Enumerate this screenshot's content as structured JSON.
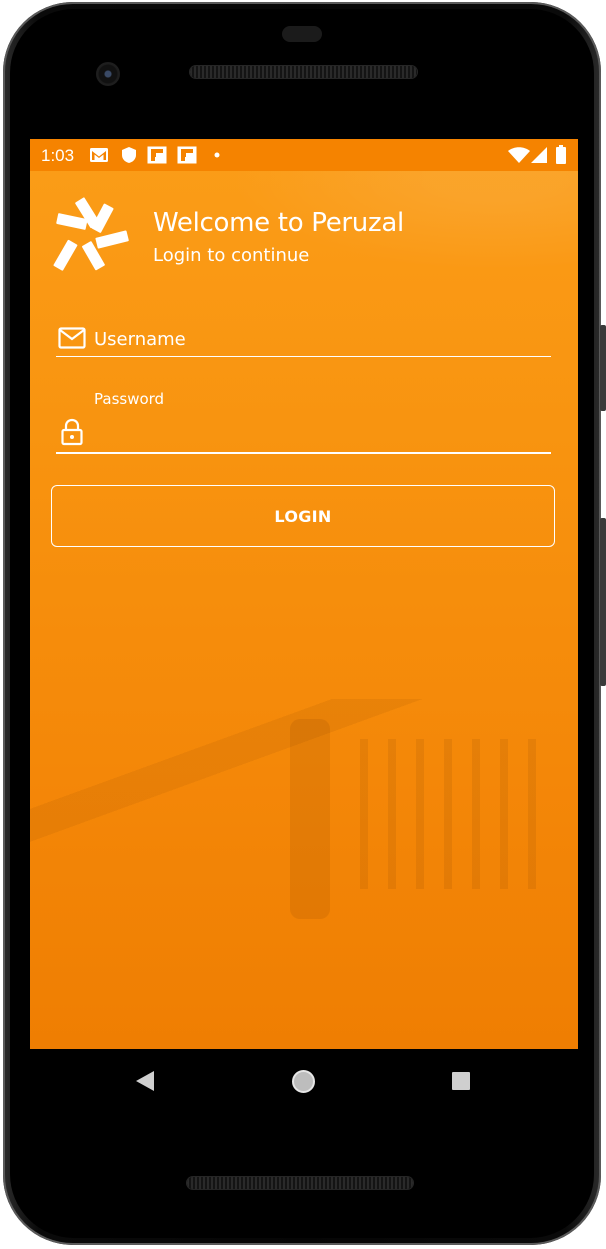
{
  "status_bar": {
    "time": "1:03",
    "left_icons": [
      "gmail-icon",
      "shield-icon",
      "flipboard-icon",
      "flipboard-icon",
      "dot-icon"
    ],
    "right_icons": [
      "wifi-icon",
      "cellular-signal-icon",
      "battery-icon"
    ],
    "background": "#f58300"
  },
  "header": {
    "logo_icon": "peruzal-logo-icon",
    "title": "Welcome to Peruzal",
    "subtitle": "Login to continue"
  },
  "form": {
    "username": {
      "icon": "mail-icon",
      "placeholder": "Username",
      "value": ""
    },
    "password": {
      "icon": "lock-icon",
      "label": "Password",
      "value": ""
    },
    "login_label": "LOGIN"
  },
  "nav_bar": {
    "back": "back-icon",
    "home": "home-icon",
    "recents": "recents-icon"
  },
  "colors": {
    "accent": "#f8930f",
    "text": "#ffffff",
    "status_bar": "#f58300"
  }
}
